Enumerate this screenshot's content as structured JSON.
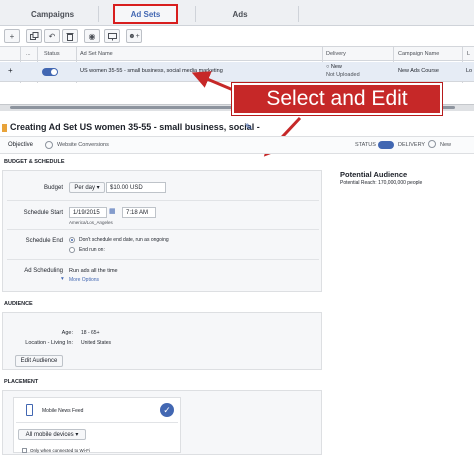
{
  "tabs": [
    {
      "label": "Campaigns"
    },
    {
      "label": "Ad Sets"
    },
    {
      "label": "Ads"
    }
  ],
  "grid": {
    "headers": [
      "...",
      "Status",
      "Ad Set Name",
      "Delivery",
      "Campaign Name",
      "L"
    ],
    "row": {
      "name": "US women 35-55 - small business, social media marketing",
      "delivery_1": "○ New",
      "delivery_2": "Not Uploaded",
      "campaign": "New Ads Course",
      "l": "Lo"
    }
  },
  "callout": "Select and Edit",
  "creating": {
    "title": "Creating Ad Set  US women 35-55 - small business, social -",
    "objective_label": "Objective",
    "objective_value": "Website Conversions",
    "status_label": "STATUS",
    "delivery_label": "DELIVERY",
    "delivery_value": "New"
  },
  "budget": {
    "section": "BUDGET & SCHEDULE",
    "budget_label": "Budget",
    "budget_type": "Per day ▾",
    "budget_amount": "$10.00 USD",
    "start_label": "Schedule Start",
    "start_date": "1/19/2015",
    "start_time": "7:18 AM",
    "timezone": "America/Los_Angeles",
    "end_label": "Schedule End",
    "end_option_1": "Don't schedule end date, run as ongoing",
    "end_option_2": "End run on:",
    "scheduling_label": "Ad Scheduling",
    "scheduling_value": "Run ads all the time",
    "more_options": "More Options"
  },
  "potential": {
    "title": "Potential Audience",
    "reach": "Potential Reach: 170,000,000 people"
  },
  "audience": {
    "section": "AUDIENCE",
    "age_label": "Age:",
    "age_value": "18 - 65+",
    "location_label": "Location - Living In:",
    "location_value": "United States",
    "edit_button": "Edit Audience"
  },
  "placement": {
    "section": "PLACEMENT",
    "item": "Mobile News Feed",
    "devices": "All mobile devices ▾",
    "wifi": "Only when connected to Wi-Fi"
  }
}
